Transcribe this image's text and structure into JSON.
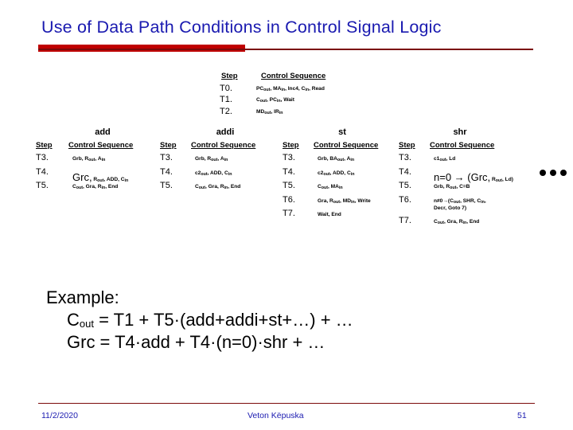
{
  "slide": {
    "title": "Use of Data Path Conditions in Control Signal Logic",
    "accent_bar_color": "#c00000",
    "rule_color": "#7b0a0a",
    "title_color": "#1a1ab0"
  },
  "fetch_table": {
    "header": {
      "step": "Step",
      "sequence": "Control Sequence"
    },
    "rows": [
      {
        "step": "T0.",
        "sequence": "PC<sub>out</sub>, MA<sub>in</sub>, Inc4, C<sub>in</sub>, Read"
      },
      {
        "step": "T1.",
        "sequence": "C<sub>out</sub>, PC<sub>in</sub>, Wait"
      },
      {
        "step": "T2.",
        "sequence": "MD<sub>out</sub>, IR<sub>in</sub>"
      }
    ]
  },
  "instruction_columns": [
    {
      "name": "add",
      "header": {
        "step": "Step",
        "sequence": "Control Sequence"
      },
      "rows": [
        {
          "step": "T3.",
          "sequence": "Grb, R<sub>out</sub>, A<sub>in</sub>",
          "emphasis": false
        },
        {
          "step": "T4.",
          "sequence": "<span class=\"big\">Grc,</span> R<sub>out</sub>, ADD, C<sub>in</sub>",
          "emphasis": true
        },
        {
          "step": "T5.",
          "sequence": "C<sub>out</sub>, Gra, R<sub>in</sub>, End",
          "emphasis": false
        }
      ]
    },
    {
      "name": "addi",
      "header": {
        "step": "Step",
        "sequence": "Control Sequence"
      },
      "rows": [
        {
          "step": "T3.",
          "sequence": "Grb, R<sub>out</sub>, A<sub>in</sub>",
          "emphasis": false
        },
        {
          "step": "T4.",
          "sequence": "c2<sub>out</sub>, ADD, C<sub>in</sub>",
          "emphasis": false
        },
        {
          "step": "T5.",
          "sequence": "C<sub>out</sub>, Gra, R<sub>in</sub>, End",
          "emphasis": false
        }
      ]
    },
    {
      "name": "st",
      "header": {
        "step": "Step",
        "sequence": "Control Sequence"
      },
      "rows": [
        {
          "step": "T3.",
          "sequence": "Grb, BA<sub>out</sub>, A<sub>in</sub>",
          "emphasis": false
        },
        {
          "step": "T4.",
          "sequence": "c2<sub>out</sub>, ADD, C<sub>in</sub>",
          "emphasis": false
        },
        {
          "step": "T5.",
          "sequence": "C<sub>out</sub>, MA<sub>in</sub>",
          "emphasis": false
        },
        {
          "step": "T6.",
          "sequence": "Gra, R<sub>out</sub>, MD<sub>in</sub>, Write",
          "emphasis": false
        },
        {
          "step": "T7.",
          "sequence": "Wait, End",
          "emphasis": false
        }
      ]
    },
    {
      "name": "shr",
      "header": {
        "step": "Step",
        "sequence": "Control Sequence"
      },
      "rows": [
        {
          "step": "T3.",
          "sequence": "c1<sub>out</sub>, Ld",
          "emphasis": false
        },
        {
          "step": "T4.",
          "sequence": "<span class=\"big\">n=0 &rarr; (Grc,</span> R<sub>out</sub>, Ld)",
          "emphasis": true
        },
        {
          "step": "T5.",
          "sequence": "Grb, R<sub>out</sub>, C=B",
          "emphasis": false
        },
        {
          "step": "T6.",
          "sequence": "n&ne;0&rarr;(C<sub>out</sub>, SHR, C<sub>in</sub>,<br>Decr, Goto 7)",
          "emphasis": false
        },
        {
          "step": "T7.",
          "sequence": "C<sub>out</sub>, Gra, R<sub>in</sub>, End",
          "emphasis": false
        }
      ]
    }
  ],
  "ellipsis_bullets": 3,
  "example": {
    "heading": "Example:",
    "line1": "C<sub>out</sub> = T1 + T5·(add+addi+st+…) + …",
    "line2": "Grc = T4·add + T4·(n=0)·shr + …"
  },
  "footer": {
    "date": "11/2/2020",
    "author": "Veton Këpuska",
    "page": "51"
  }
}
